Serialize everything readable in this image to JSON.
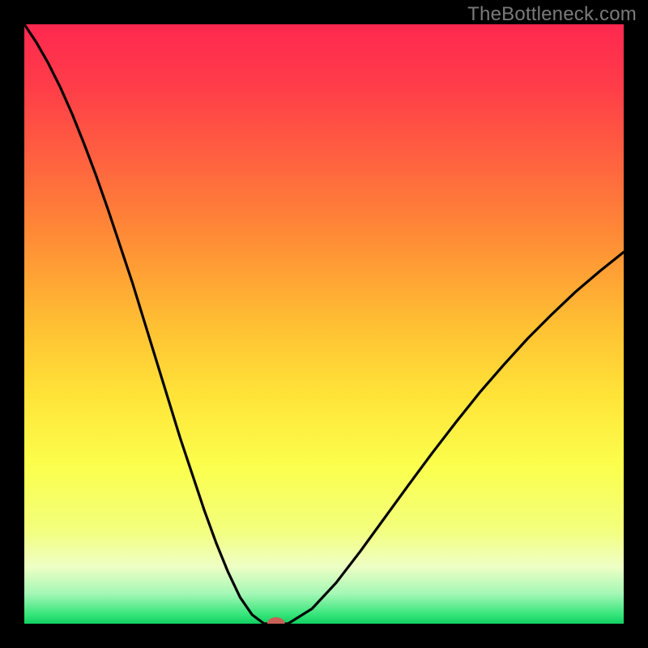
{
  "watermark": "TheBottleneck.com",
  "chart_data": {
    "type": "line",
    "title": "",
    "xlabel": "",
    "ylabel": "",
    "xlim": [
      0,
      100
    ],
    "ylim": [
      0,
      100
    ],
    "curve": {
      "series_name": "bottleneck",
      "x": [
        0,
        2,
        4,
        6,
        8,
        10,
        12,
        14,
        16,
        18,
        20,
        22,
        24,
        26,
        28,
        30,
        32,
        34,
        36,
        38,
        40,
        44,
        48,
        52,
        56,
        60,
        64,
        68,
        72,
        76,
        80,
        84,
        88,
        92,
        96,
        100
      ],
      "y": [
        100,
        97,
        93.5,
        89.5,
        85,
        80,
        74.7,
        69,
        63,
        57,
        50.5,
        44,
        37.5,
        31,
        25,
        19,
        13.5,
        8.6,
        4.4,
        1.5,
        0,
        0,
        2.5,
        6.8,
        12,
        17.5,
        23,
        28.4,
        33.6,
        38.6,
        43.2,
        47.6,
        51.6,
        55.4,
        58.8,
        62
      ]
    },
    "optimum_marker": {
      "x": 42,
      "y": 0
    },
    "gradient_stops": [
      {
        "pos": 0.0,
        "color": "#ff2850"
      },
      {
        "pos": 0.1,
        "color": "#ff3c49"
      },
      {
        "pos": 0.22,
        "color": "#ff6040"
      },
      {
        "pos": 0.35,
        "color": "#ff8a36"
      },
      {
        "pos": 0.5,
        "color": "#ffbf33"
      },
      {
        "pos": 0.62,
        "color": "#ffe438"
      },
      {
        "pos": 0.74,
        "color": "#fbff4d"
      },
      {
        "pos": 0.845,
        "color": "#f3ff7e"
      },
      {
        "pos": 0.905,
        "color": "#eeffc5"
      },
      {
        "pos": 0.95,
        "color": "#a4f7b5"
      },
      {
        "pos": 0.985,
        "color": "#35e57a"
      },
      {
        "pos": 1.0,
        "color": "#12cf62"
      }
    ]
  }
}
